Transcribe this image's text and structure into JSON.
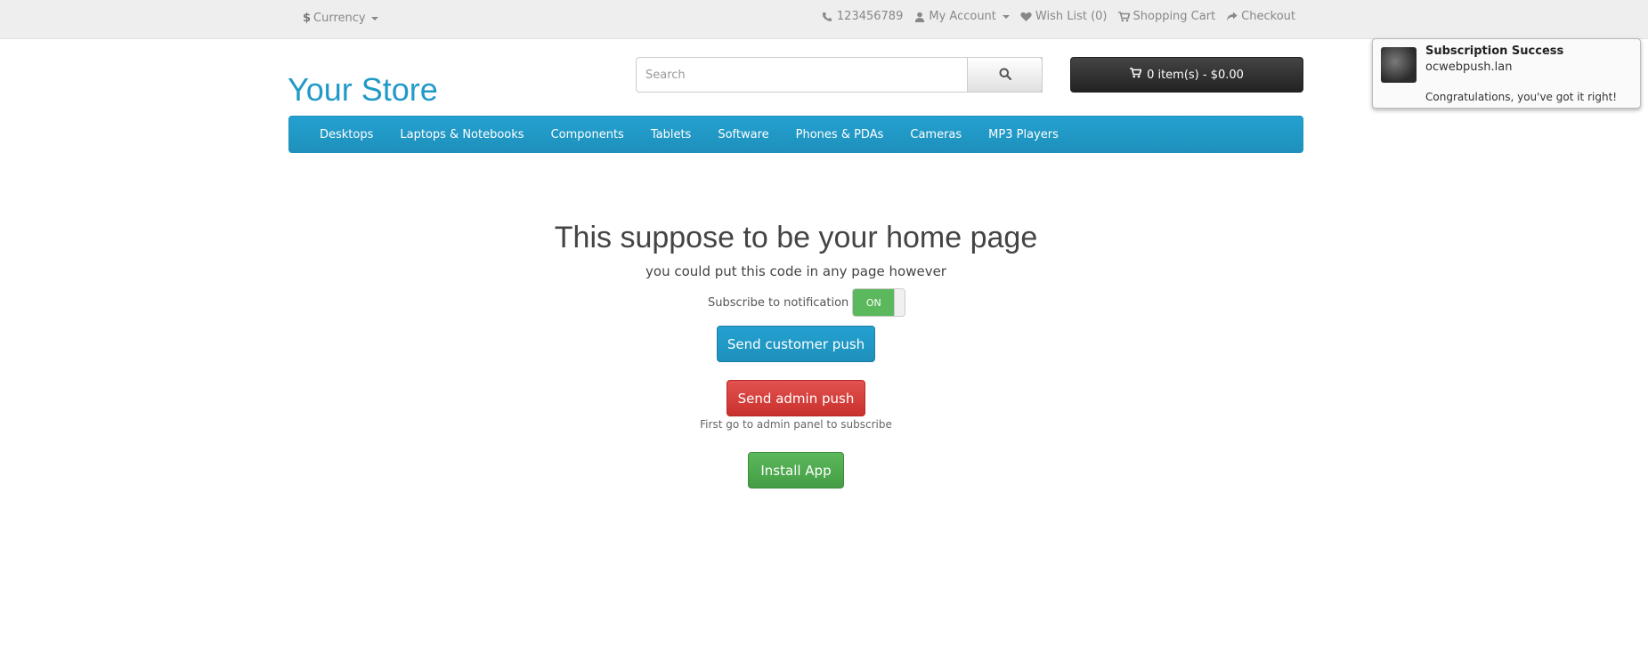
{
  "topbar": {
    "currency_symbol": "$",
    "currency_label": "Currency",
    "phone": "123456789",
    "my_account": "My Account",
    "wishlist": "Wish List (0)",
    "shopping_cart": "Shopping Cart",
    "checkout": "Checkout"
  },
  "header": {
    "logo": "Your Store",
    "search_placeholder": "Search",
    "cart_label": "0 item(s) - $0.00"
  },
  "nav": {
    "items": [
      "Desktops",
      "Laptops & Notebooks",
      "Components",
      "Tablets",
      "Software",
      "Phones & PDAs",
      "Cameras",
      "MP3 Players"
    ]
  },
  "main": {
    "title": "This suppose to be your home page",
    "subtitle": "you could put this code in any page however",
    "subscribe_label": "Subscribe to notification",
    "toggle_state": "ON",
    "send_customer_push": "Send customer push",
    "send_admin_push": "Send admin push",
    "admin_note": "First go to admin panel to subscribe",
    "install_app": "Install App"
  },
  "toast": {
    "title": "Subscription Success",
    "site": "ocwebpush.lan",
    "message": "Congratulations, you've got it right!"
  },
  "colors": {
    "accent_blue": "#229ac8",
    "danger_red": "#d9534f",
    "success_green": "#5cb85c",
    "cart_dark": "#303030"
  }
}
